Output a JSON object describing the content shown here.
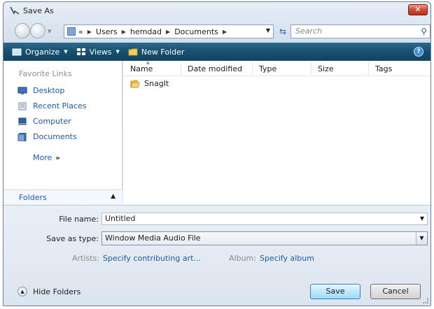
{
  "window": {
    "title": "Save As",
    "close_label": "✕"
  },
  "address": {
    "crumbs": [
      "«",
      "Users",
      "hemdad",
      "Documents"
    ],
    "search_placeholder": "Search"
  },
  "toolbar": {
    "organize": "Organize",
    "views": "Views",
    "new_folder": "New Folder",
    "help": "?"
  },
  "nav_pane": {
    "title": "Favorite Links",
    "items": [
      {
        "label": "Desktop",
        "icon": "desktop-icon"
      },
      {
        "label": "Recent Places",
        "icon": "recent-places-icon"
      },
      {
        "label": "Computer",
        "icon": "computer-icon"
      },
      {
        "label": "Documents",
        "icon": "documents-icon"
      }
    ],
    "more": "More",
    "folders": "Folders"
  },
  "file_list": {
    "columns": [
      "Name",
      "Date modified",
      "Type",
      "Size",
      "Tags"
    ],
    "items": [
      {
        "name": "SnagIt",
        "icon": "folder-icon"
      }
    ]
  },
  "form": {
    "file_name_label": "File name:",
    "file_name_value": "Untitled",
    "save_type_label": "Save as type:",
    "save_type_value": "Window Media Audio File",
    "artists_label": "Artists:",
    "artists_value": "Specify contributing art...",
    "album_label": "Album:",
    "album_value": "Specify album"
  },
  "footer": {
    "hide_folders": "Hide Folders",
    "save": "Save",
    "cancel": "Cancel"
  },
  "colors": {
    "link": "#1e5aa8",
    "toolbar": "#174f6e",
    "close": "#cf4a32"
  }
}
